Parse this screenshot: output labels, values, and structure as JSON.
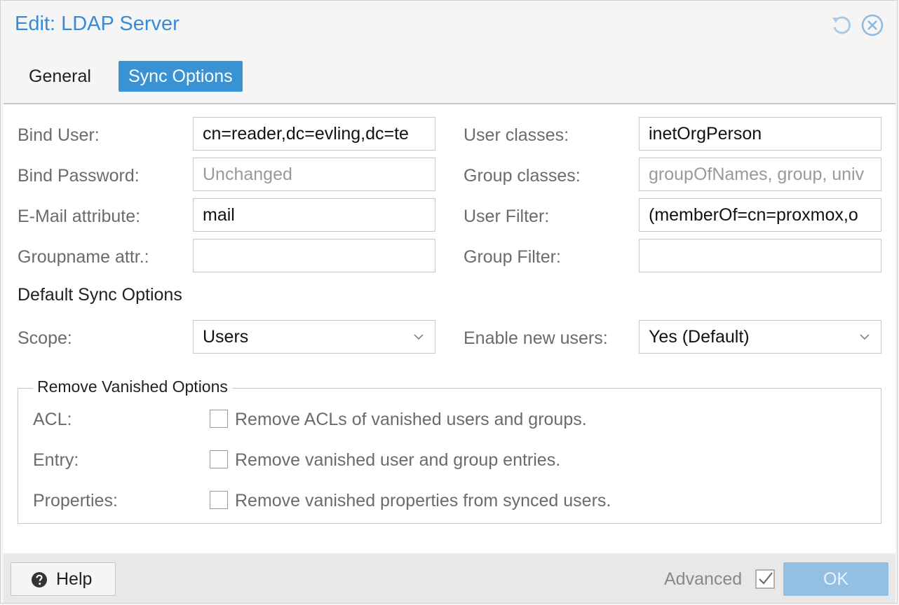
{
  "window": {
    "title": "Edit: LDAP Server"
  },
  "tabs": [
    {
      "label": "General"
    },
    {
      "label": "Sync Options"
    }
  ],
  "form": {
    "bind_user": {
      "label": "Bind User:",
      "value": "cn=reader,dc=evling,dc=te"
    },
    "bind_password": {
      "label": "Bind Password:",
      "placeholder": "Unchanged"
    },
    "email_attribute": {
      "label": "E-Mail attribute:",
      "value": "mail"
    },
    "groupname_attr": {
      "label": "Groupname attr.:",
      "value": ""
    },
    "user_classes": {
      "label": "User classes:",
      "value": "inetOrgPerson"
    },
    "group_classes": {
      "label": "Group classes:",
      "placeholder": "groupOfNames, group, univ"
    },
    "user_filter": {
      "label": "User Filter:",
      "value": "(memberOf=cn=proxmox,o"
    },
    "group_filter": {
      "label": "Group Filter:",
      "value": ""
    }
  },
  "sync": {
    "section_title": "Default Sync Options",
    "scope": {
      "label": "Scope:",
      "value": "Users"
    },
    "enable_new_users": {
      "label": "Enable new users:",
      "value": "Yes (Default)"
    }
  },
  "vanished": {
    "legend": "Remove Vanished Options",
    "options": [
      {
        "label": "ACL:",
        "text": "Remove ACLs of vanished users and groups.",
        "checked": false
      },
      {
        "label": "Entry:",
        "text": "Remove vanished user and group entries.",
        "checked": false
      },
      {
        "label": "Properties:",
        "text": "Remove vanished properties from synced users.",
        "checked": false
      }
    ]
  },
  "footer": {
    "help_label": "Help",
    "advanced_label": "Advanced",
    "advanced_checked": true,
    "ok_label": "OK"
  },
  "colors": {
    "accent": "#3892d4",
    "title": "#3a8ad6",
    "ok_disabled": "#93bfe3"
  },
  "icons": [
    "reset-icon",
    "close-icon",
    "chevron-down-icon",
    "help-icon",
    "checkmark-icon"
  ]
}
